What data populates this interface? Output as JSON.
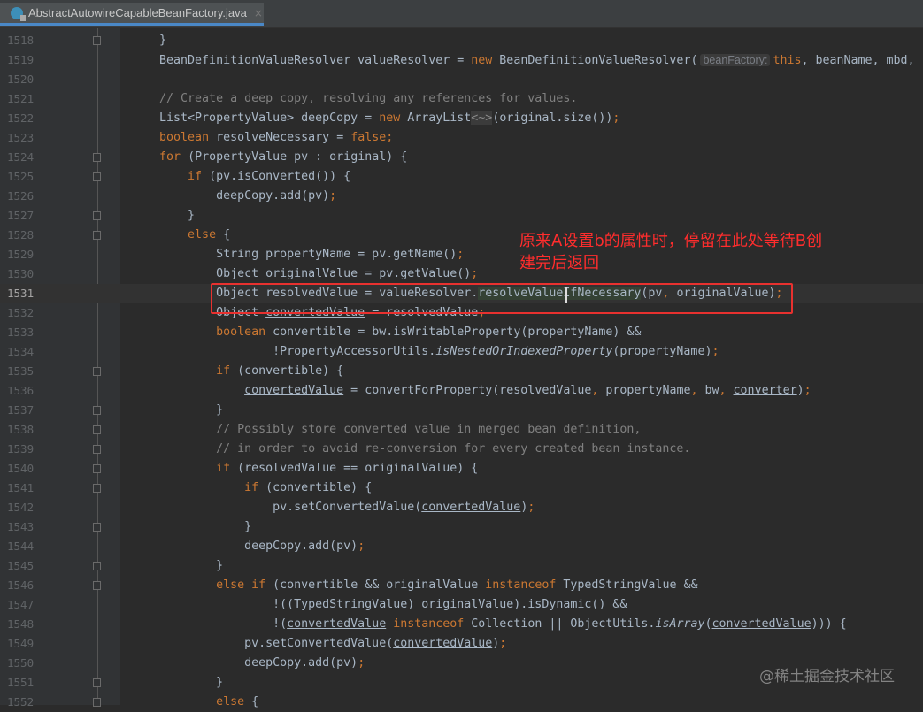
{
  "tab": {
    "filename": "AbstractAutowireCapableBeanFactory.java",
    "close": "×"
  },
  "current_line": 1531,
  "annotation": {
    "line1": "原来A设置b的属性时，停留在此处等待B创",
    "line2": "建完后返回"
  },
  "watermark": "@稀土掘金技术社区",
  "lines": [
    {
      "n": 1518,
      "fold": true,
      "t": [
        [
          "    }",
          "p"
        ]
      ]
    },
    {
      "n": 1519,
      "t": [
        [
          "    BeanDefinitionValueResolver valueResolver = ",
          "p"
        ],
        [
          "new",
          "k"
        ],
        [
          " BeanDefinitionValueResolver(",
          "p"
        ],
        [
          "beanFactory:",
          "h"
        ],
        [
          "this",
          "k"
        ],
        [
          ", beanName, mbd,",
          "p"
        ]
      ]
    },
    {
      "n": 1520,
      "t": []
    },
    {
      "n": 1521,
      "t": [
        [
          "    // Create a deep copy, resolving any references for values.",
          "c"
        ]
      ]
    },
    {
      "n": 1522,
      "t": [
        [
          "    List<PropertyValue> deepCopy = ",
          "p"
        ],
        [
          "new",
          "k"
        ],
        [
          " ArrayList",
          "p"
        ],
        [
          "<~>",
          "d"
        ],
        [
          "(original.size())",
          "p"
        ],
        [
          ";",
          "k"
        ]
      ]
    },
    {
      "n": 1523,
      "t": [
        [
          "    ",
          "p"
        ],
        [
          "boolean",
          "k"
        ],
        [
          " ",
          "p"
        ],
        [
          "resolveNecessary",
          "u"
        ],
        [
          " = ",
          "p"
        ],
        [
          "false;",
          "k"
        ]
      ]
    },
    {
      "n": 1524,
      "fold": true,
      "t": [
        [
          "    ",
          "p"
        ],
        [
          "for",
          "k"
        ],
        [
          " (PropertyValue pv : original) {",
          "p"
        ]
      ]
    },
    {
      "n": 1525,
      "fold": true,
      "t": [
        [
          "        ",
          "p"
        ],
        [
          "if",
          "k"
        ],
        [
          " (pv.isConverted()) {",
          "p"
        ]
      ]
    },
    {
      "n": 1526,
      "t": [
        [
          "            deepCopy.add(pv)",
          "p"
        ],
        [
          ";",
          "k"
        ]
      ]
    },
    {
      "n": 1527,
      "fold": true,
      "t": [
        [
          "        }",
          "p"
        ]
      ]
    },
    {
      "n": 1528,
      "fold": true,
      "t": [
        [
          "        ",
          "p"
        ],
        [
          "else",
          "k"
        ],
        [
          " {",
          "p"
        ]
      ]
    },
    {
      "n": 1529,
      "t": [
        [
          "            String propertyName = pv.getName()",
          "p"
        ],
        [
          ";",
          "k"
        ]
      ]
    },
    {
      "n": 1530,
      "t": [
        [
          "            Object originalValue = pv.getValue()",
          "p"
        ],
        [
          ";",
          "k"
        ]
      ]
    },
    {
      "n": 1531,
      "t": [
        [
          "            Object resolvedValue = valueResolver.",
          "p"
        ],
        [
          "resolveValueIfNecessary",
          "g"
        ],
        [
          "(pv",
          "p"
        ],
        [
          ",",
          "k"
        ],
        [
          " originalValue)",
          "p"
        ],
        [
          ";",
          "k"
        ]
      ]
    },
    {
      "n": 1532,
      "t": [
        [
          "            Object ",
          "p"
        ],
        [
          "convertedValue",
          "u"
        ],
        [
          " = resolvedValue",
          "p"
        ],
        [
          ";",
          "k"
        ]
      ]
    },
    {
      "n": 1533,
      "t": [
        [
          "            ",
          "p"
        ],
        [
          "boolean",
          "k"
        ],
        [
          " convertible = bw.isWritableProperty(propertyName) &&",
          "p"
        ]
      ]
    },
    {
      "n": 1534,
      "t": [
        [
          "                    !PropertyAccessorUtils.",
          "p"
        ],
        [
          "isNestedOrIndexedProperty",
          "i"
        ],
        [
          "(propertyName)",
          "p"
        ],
        [
          ";",
          "k"
        ]
      ]
    },
    {
      "n": 1535,
      "fold": true,
      "t": [
        [
          "            ",
          "p"
        ],
        [
          "if",
          "k"
        ],
        [
          " (convertible) {",
          "p"
        ]
      ]
    },
    {
      "n": 1536,
      "t": [
        [
          "                ",
          "p"
        ],
        [
          "convertedValue",
          "u"
        ],
        [
          " = convertForProperty(resolvedValue",
          "p"
        ],
        [
          ",",
          "k"
        ],
        [
          " propertyName",
          "p"
        ],
        [
          ",",
          "k"
        ],
        [
          " bw",
          "p"
        ],
        [
          ",",
          "k"
        ],
        [
          " ",
          "p"
        ],
        [
          "converter",
          "u"
        ],
        [
          ")",
          "p"
        ],
        [
          ";",
          "k"
        ]
      ]
    },
    {
      "n": 1537,
      "fold": true,
      "t": [
        [
          "            }",
          "p"
        ]
      ]
    },
    {
      "n": 1538,
      "fold": true,
      "t": [
        [
          "            // Possibly store converted value in merged bean definition,",
          "c"
        ]
      ]
    },
    {
      "n": 1539,
      "fold": true,
      "t": [
        [
          "            // in order to avoid re-conversion for every created bean instance.",
          "c"
        ]
      ]
    },
    {
      "n": 1540,
      "fold": true,
      "t": [
        [
          "            ",
          "p"
        ],
        [
          "if",
          "k"
        ],
        [
          " (resolvedValue == originalValue) {",
          "p"
        ]
      ]
    },
    {
      "n": 1541,
      "fold": true,
      "t": [
        [
          "                ",
          "p"
        ],
        [
          "if",
          "k"
        ],
        [
          " (convertible) {",
          "p"
        ]
      ]
    },
    {
      "n": 1542,
      "t": [
        [
          "                    pv.setConvertedValue(",
          "p"
        ],
        [
          "convertedValue",
          "u"
        ],
        [
          ")",
          "p"
        ],
        [
          ";",
          "k"
        ]
      ]
    },
    {
      "n": 1543,
      "fold": true,
      "t": [
        [
          "                }",
          "p"
        ]
      ]
    },
    {
      "n": 1544,
      "t": [
        [
          "                deepCopy.add(pv)",
          "p"
        ],
        [
          ";",
          "k"
        ]
      ]
    },
    {
      "n": 1545,
      "fold": true,
      "t": [
        [
          "            }",
          "p"
        ]
      ]
    },
    {
      "n": 1546,
      "fold": true,
      "t": [
        [
          "            ",
          "p"
        ],
        [
          "else if",
          "k"
        ],
        [
          " (convertible && originalValue ",
          "p"
        ],
        [
          "instanceof",
          "k"
        ],
        [
          " TypedStringValue &&",
          "p"
        ]
      ]
    },
    {
      "n": 1547,
      "t": [
        [
          "                    !((TypedStringValue) originalValue).isDynamic() &&",
          "p"
        ]
      ]
    },
    {
      "n": 1548,
      "t": [
        [
          "                    !(",
          "p"
        ],
        [
          "convertedValue",
          "u"
        ],
        [
          " ",
          "p"
        ],
        [
          "instanceof",
          "k"
        ],
        [
          " Collection || ObjectUtils.",
          "p"
        ],
        [
          "isArray",
          "i"
        ],
        [
          "(",
          "p"
        ],
        [
          "convertedValue",
          "u"
        ],
        [
          ")))",
          "p"
        ],
        [
          " {",
          "p"
        ]
      ]
    },
    {
      "n": 1549,
      "t": [
        [
          "                pv.setConvertedValue(",
          "p"
        ],
        [
          "convertedValue",
          "u"
        ],
        [
          ")",
          "p"
        ],
        [
          ";",
          "k"
        ]
      ]
    },
    {
      "n": 1550,
      "t": [
        [
          "                deepCopy.add(pv)",
          "p"
        ],
        [
          ";",
          "k"
        ]
      ]
    },
    {
      "n": 1551,
      "fold": true,
      "t": [
        [
          "            }",
          "p"
        ]
      ]
    },
    {
      "n": 1552,
      "fold": true,
      "t": [
        [
          "            ",
          "p"
        ],
        [
          "else",
          "k"
        ],
        [
          " {",
          "p"
        ]
      ]
    }
  ]
}
